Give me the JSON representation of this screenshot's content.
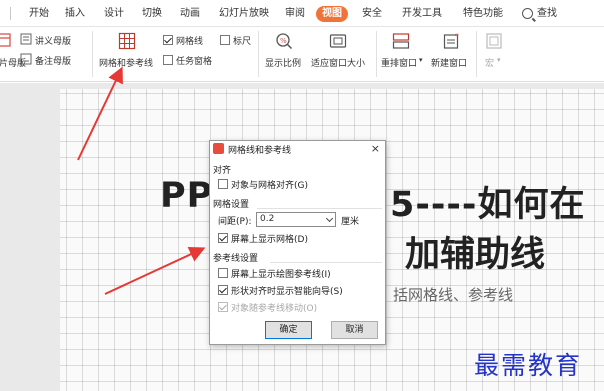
{
  "menubar": {
    "items": [
      "开始",
      "插入",
      "设计",
      "切换",
      "动画",
      "幻灯片放映",
      "审阅",
      "视图",
      "安全",
      "开发工具",
      "特色功能"
    ],
    "active_index": 7,
    "search_label": "查找"
  },
  "ribbon": {
    "slide_master_partial": "片母版",
    "handout_master": "讲义母版",
    "notes_master": "备注母版",
    "grid_and_guides": "网格和参考线",
    "gridlines": "网格线",
    "ruler": "标尺",
    "task_pane": "任务窗格",
    "show_ratio": "显示比例",
    "fit_window": "适应窗口大小",
    "rearrange_window": "重排窗口",
    "new_window": "新建窗口",
    "macro": "宏"
  },
  "slide": {
    "title_line1_left": "PP",
    "title_line1_right": "5----如何在",
    "title_line2_right": "加辅助线",
    "subtitle": "括网格线、参考线"
  },
  "dialog": {
    "title": "网格线和参考线",
    "close": "×",
    "snap_section": "对齐",
    "snap_to_grid": "对象与网格对齐(G)",
    "grid_section": "网格设置",
    "spacing_label": "间距(P):",
    "spacing_value": "0.2",
    "spacing_unit": "厘米",
    "show_grid": "屏幕上显示网格(D)",
    "guides_section": "参考线设置",
    "show_drawing_guides": "屏幕上显示绘图参考线(I)",
    "smart_guides": "形状对齐时显示智能向导(S)",
    "objects_move_with_guides": "对象随参考线移动(O)",
    "ok": "确定",
    "cancel": "取消"
  },
  "watermark": "最需教育",
  "colors": {
    "accent": "#f2733a",
    "arrow": "#e53935",
    "watermark": "#2433c8"
  }
}
